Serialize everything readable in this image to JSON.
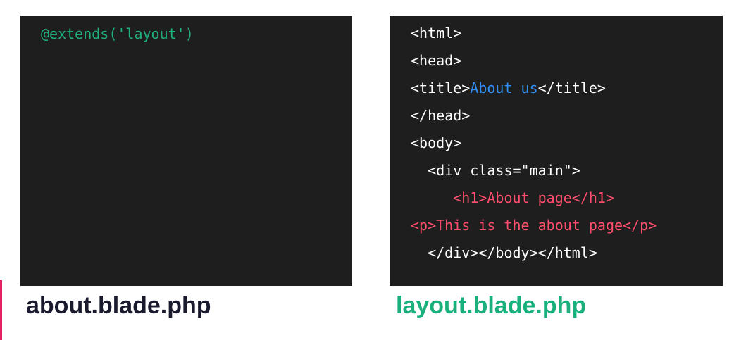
{
  "colors": {
    "panel_bg": "#1e1e1e",
    "plain": "#ffffff",
    "green": "#21b07c",
    "blue": "#2f8ff5",
    "pink": "#ff4d6d",
    "caption_dark": "#1a1a2e",
    "caption_green": "#1ab07c",
    "accent": "#e91e63"
  },
  "left_panel": {
    "lines": [
      [
        {
          "text": "@extends('layout')",
          "color": "green"
        }
      ]
    ],
    "caption": "about.blade.php"
  },
  "right_panel": {
    "lines": [
      [
        {
          "text": "<html>",
          "color": "plain"
        }
      ],
      [
        {
          "text": "<head>",
          "color": "plain"
        }
      ],
      [
        {
          "text": "<title>",
          "color": "plain"
        },
        {
          "text": "About us",
          "color": "blue"
        },
        {
          "text": "</title>",
          "color": "plain"
        }
      ],
      [
        {
          "text": "</head>",
          "color": "plain"
        }
      ],
      [
        {
          "text": "<body>",
          "color": "plain"
        }
      ],
      [
        {
          "text": "  <div class=\"main\">",
          "color": "plain"
        }
      ],
      [
        {
          "text": "     <h1>About page</h1>",
          "color": "pink"
        }
      ],
      [
        {
          "text": "<p>This is the about page</p>",
          "color": "pink"
        }
      ],
      [
        {
          "text": "  </div></body></html>",
          "color": "plain"
        }
      ]
    ],
    "caption": "layout.blade.php"
  }
}
